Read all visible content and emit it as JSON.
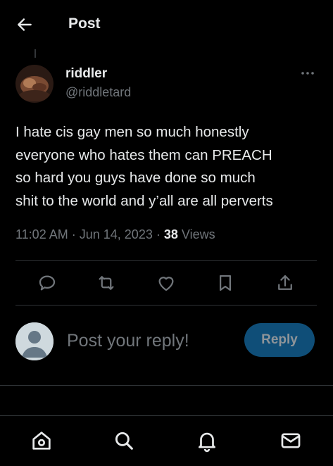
{
  "header": {
    "title": "Post",
    "back_icon": "arrow-left-icon"
  },
  "post": {
    "author_name": "riddler",
    "author_handle": "@riddletard",
    "text": "I hate cis gay men so much honestly\neveryone who hates them can PREACH\nso hard you guys have done so much\nshit to the world and y’all are all perverts",
    "time": "11:02 AM",
    "separator": "·",
    "date": "Jun 14, 2023",
    "view_count": "38",
    "views_label": "Views"
  },
  "actions": [
    "reply-icon",
    "repost-icon",
    "like-icon",
    "bookmark-icon",
    "share-icon"
  ],
  "reply_box": {
    "placeholder": "Post your reply!",
    "button_label": "Reply"
  },
  "bottom_nav": [
    "home-icon",
    "search-icon",
    "notifications-icon",
    "messages-icon"
  ],
  "colors": {
    "background": "#000000",
    "text": "#e7e9ea",
    "muted": "#71767b",
    "reply_button": "#0f4e78",
    "divider": "#2f3336"
  }
}
